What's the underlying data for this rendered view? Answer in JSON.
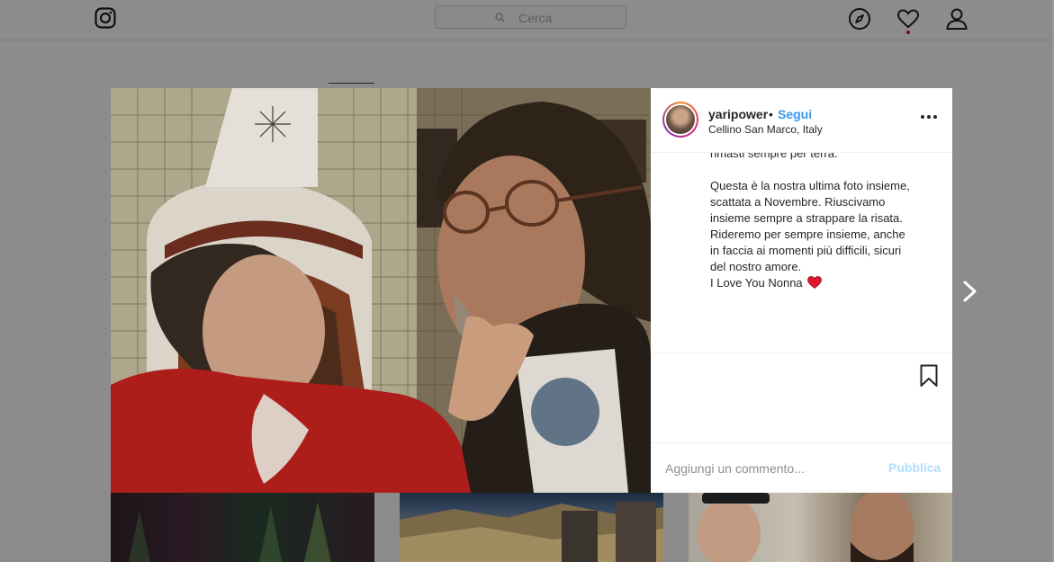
{
  "nav": {
    "logo_icon": "instagram-glyph-icon",
    "search_placeholder": "Cerca",
    "icons": [
      "explore-compass-icon",
      "activity-heart-icon",
      "profile-icon"
    ]
  },
  "post": {
    "username": "yaripower",
    "separator": "•",
    "follow_label": "Segui",
    "location": "Cellino San Marco, Italy",
    "caption_lines_1": [
      "rimasti sempre per terra."
    ],
    "caption_lines_2": [
      "Questa è la nostra ultima foto insieme,",
      "scattata a Novembre. Riuscivamo",
      "insieme sempre a strappare la risata.",
      "Rideremo per sempre insieme, anche",
      "in faccia ai momenti più difficili, sicuri",
      "del nostro amore."
    ],
    "caption_last": "I Love You Nonna",
    "caption_emoji": "red-heart-icon",
    "comment_placeholder": "Aggiungi un commento...",
    "publish_label": "Pubblica"
  },
  "colors": {
    "follow_blue": "#3897f0",
    "publish_disabled": "#b2dffc",
    "heart_red": "#e0162b",
    "overlay_gray": "#8c8c8c"
  }
}
